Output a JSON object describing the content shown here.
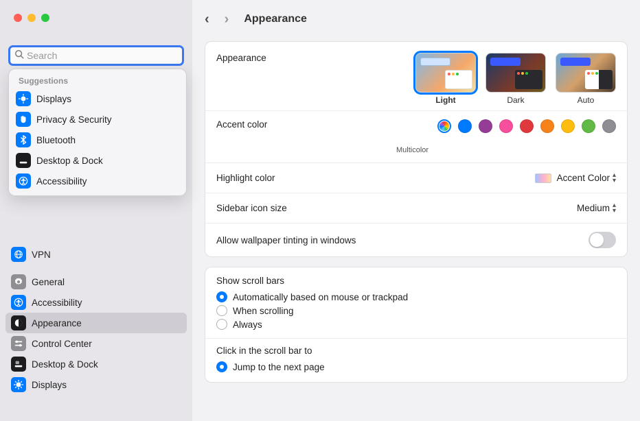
{
  "header": {
    "title": "Appearance"
  },
  "search": {
    "placeholder": "Search"
  },
  "suggestions": {
    "heading": "Suggestions",
    "items": [
      {
        "label": "Displays"
      },
      {
        "label": "Privacy & Security"
      },
      {
        "label": "Bluetooth"
      },
      {
        "label": "Desktop & Dock"
      },
      {
        "label": "Accessibility"
      }
    ]
  },
  "sidebar": {
    "group1": [
      {
        "label": "VPN"
      }
    ],
    "group2": [
      {
        "label": "General"
      },
      {
        "label": "Accessibility"
      },
      {
        "label": "Appearance"
      },
      {
        "label": "Control Center"
      },
      {
        "label": "Desktop & Dock"
      },
      {
        "label": "Displays"
      }
    ]
  },
  "appearance": {
    "row_label": "Appearance",
    "options": {
      "light": "Light",
      "dark": "Dark",
      "auto": "Auto"
    }
  },
  "accent": {
    "label": "Accent color",
    "selected_name": "Multicolor"
  },
  "highlight": {
    "label": "Highlight color",
    "value": "Accent Color"
  },
  "sidebar_icon": {
    "label": "Sidebar icon size",
    "value": "Medium"
  },
  "tint": {
    "label": "Allow wallpaper tinting in windows"
  },
  "scrollbars": {
    "title": "Show scroll bars",
    "opt1": "Automatically based on mouse or trackpad",
    "opt2": "When scrolling",
    "opt3": "Always"
  },
  "click_scroll": {
    "title": "Click in the scroll bar to",
    "opt1": "Jump to the next page"
  }
}
